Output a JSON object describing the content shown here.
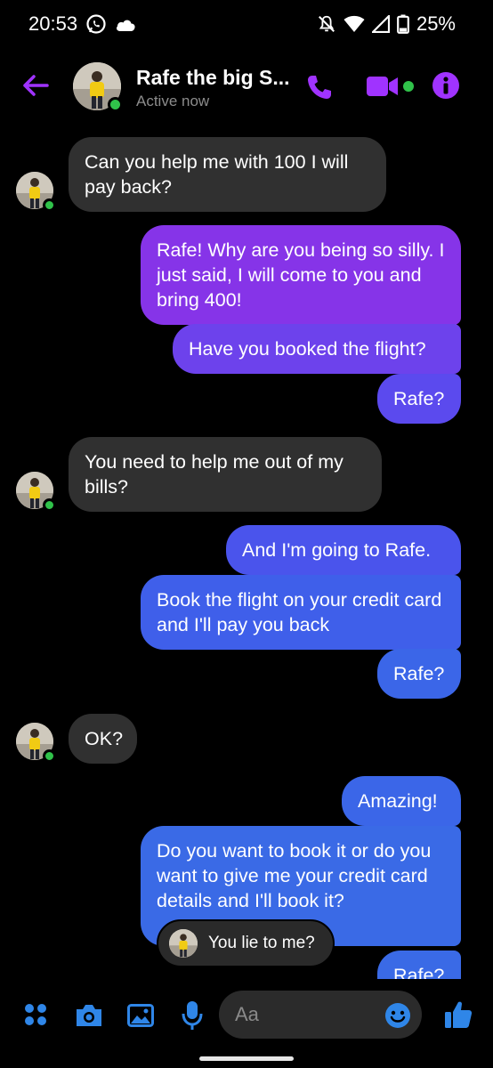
{
  "status_bar": {
    "time": "20:53",
    "battery": "25%",
    "icons": [
      "whatsapp-icon",
      "cloud-icon",
      "bell-off-icon",
      "wifi-icon",
      "signal-icon",
      "battery-icon"
    ]
  },
  "header": {
    "contact_name": "Rafe the big S...",
    "status": "Active now",
    "accent_color": "#a033ff",
    "online_color": "#30c24a"
  },
  "messages": [
    {
      "side": "in",
      "text": "Can you help me with 100 I will pay back?"
    },
    {
      "side": "out",
      "text": "Rafe! Why are you being so silly. I just said, I will come to you and bring 400!"
    },
    {
      "side": "out",
      "text": "Have you booked the flight?"
    },
    {
      "side": "out",
      "text": "Rafe?"
    },
    {
      "side": "in",
      "text": "You need to help me out of my bills?"
    },
    {
      "side": "out",
      "text": "And I'm going to Rafe."
    },
    {
      "side": "out",
      "text": "Book the flight on your credit card and I'll pay you back"
    },
    {
      "side": "out",
      "text": "Rafe?"
    },
    {
      "side": "in",
      "text": "OK?"
    },
    {
      "side": "out",
      "text": "Amazing!"
    },
    {
      "side": "out",
      "text": "Do you want to book it or do you want to give me your credit card details and I'll book it?"
    },
    {
      "side": "out",
      "text": "Rafe?"
    }
  ],
  "reply_preview": {
    "text": "You lie to me?"
  },
  "composer": {
    "placeholder": "Aa",
    "icon_color": "#2f86e8"
  }
}
